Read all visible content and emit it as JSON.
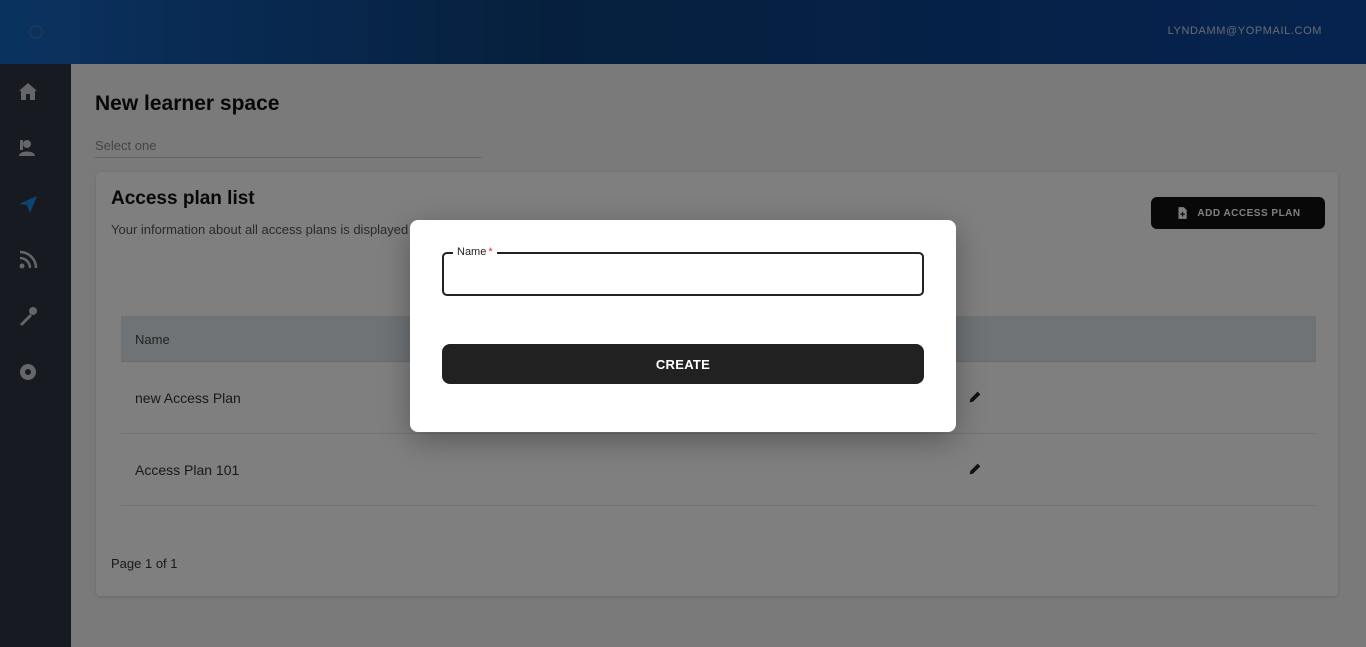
{
  "topbar": {
    "user_email": "LYNDAMM@YOPMAIL.COM"
  },
  "sidebar": {
    "items": [
      {
        "name": "home",
        "icon": "home-icon"
      },
      {
        "name": "learners",
        "icon": "person-icon"
      },
      {
        "name": "access-plans",
        "icon": "send-icon"
      },
      {
        "name": "feed",
        "icon": "rss-icon"
      },
      {
        "name": "tools",
        "icon": "wrench-icon"
      },
      {
        "name": "settings",
        "icon": "gear-icon"
      }
    ]
  },
  "main": {
    "page_title": "New learner space",
    "space_select_placeholder": "Select one",
    "card": {
      "title": "Access plan list",
      "subtitle": "Your information about all access plans is displayed here",
      "add_button_label": "ADD ACCESS PLAN",
      "column_name": "Name",
      "rows": [
        {
          "name": "new Access Plan"
        },
        {
          "name": "Access Plan 101"
        }
      ],
      "pagination": "Page 1 of 1"
    }
  },
  "dialog": {
    "name_label": "Name",
    "required_marker": "*",
    "name_value": "",
    "create_label": "CREATE"
  },
  "colors": {
    "topbar": "#0d47a1",
    "sidebar": "#2e3440",
    "active_nav": "#1e88e5",
    "button": "#212121",
    "required": "#d32f2f"
  }
}
